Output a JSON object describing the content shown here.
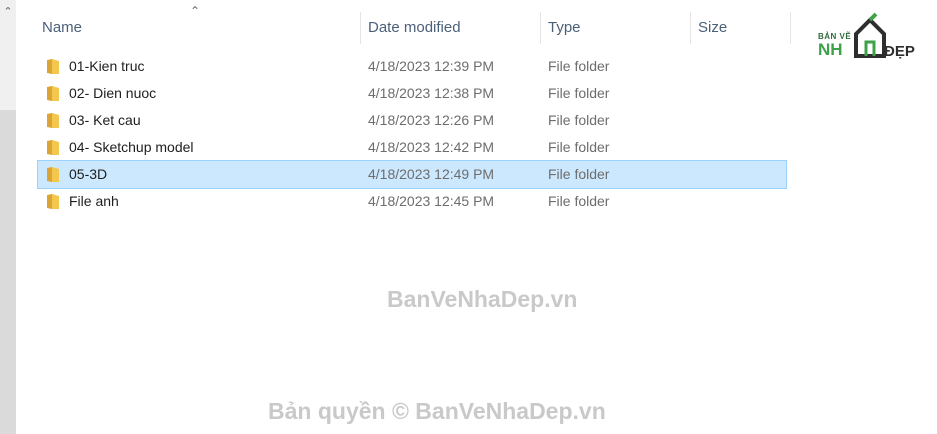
{
  "columns": {
    "name": "Name",
    "date": "Date modified",
    "type": "Type",
    "size": "Size"
  },
  "rows": [
    {
      "name": "01-Kien truc",
      "date": "4/18/2023 12:39 PM",
      "type": "File folder",
      "selected": false
    },
    {
      "name": "02- Dien nuoc",
      "date": "4/18/2023 12:38 PM",
      "type": "File folder",
      "selected": false
    },
    {
      "name": "03- Ket cau",
      "date": "4/18/2023 12:26 PM",
      "type": "File folder",
      "selected": false
    },
    {
      "name": "04- Sketchup model",
      "date": "4/18/2023 12:42 PM",
      "type": "File folder",
      "selected": false
    },
    {
      "name": "05-3D",
      "date": "4/18/2023 12:49 PM",
      "type": "File folder",
      "selected": true
    },
    {
      "name": "File anh",
      "date": "4/18/2023 12:45 PM",
      "type": "File folder",
      "selected": false
    }
  ],
  "icons": {
    "folder": "folder-icon",
    "sort": "sort-ascending-icon",
    "scroll_up": "scroll-up-icon"
  },
  "colors": {
    "selection_bg": "#cce8ff",
    "selection_border": "#99d1ff",
    "folder": "#e8b83a",
    "header_text": "#4c607a"
  },
  "logo": {
    "top_text": "BẢN VẼ",
    "main_text": "NH",
    "suffix_text": "ĐẸP"
  },
  "watermarks": {
    "center": "BanVeNhaDep.vn",
    "bottom": "Bản quyền © BanVeNhaDep.vn"
  }
}
